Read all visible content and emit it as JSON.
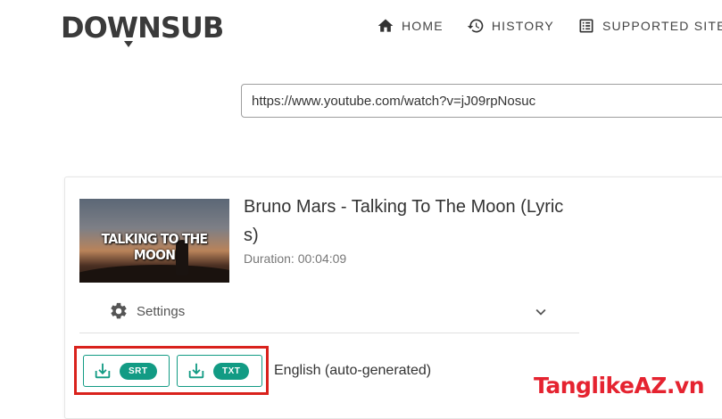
{
  "header": {
    "logo_text": "DOWNSUB",
    "nav": [
      {
        "label": "HOME",
        "icon": "home-icon"
      },
      {
        "label": "HISTORY",
        "icon": "history-icon"
      },
      {
        "label": "SUPPORTED SITES",
        "icon": "list-icon"
      }
    ]
  },
  "search": {
    "value": "https://www.youtube.com/watch?v=jJ09rpNosuc"
  },
  "video": {
    "thumbnail_text": "TALKING TO THE MOON",
    "title": "Bruno Mars - Talking To The Moon (Lyrics)",
    "duration": "Duration: 00:04:09"
  },
  "settings": {
    "label": "Settings",
    "icon": "gear-icon",
    "toggle_icon": "chevron-down-icon"
  },
  "subtitle": {
    "srt_label": "SRT",
    "txt_label": "TXT",
    "language": "English (auto-generated)",
    "download_icon": "download-icon"
  },
  "colors": {
    "accent": "#129b84",
    "highlight_border": "#d9221c",
    "watermark": "#e52330"
  },
  "watermark": "TanglikeAZ.vn"
}
